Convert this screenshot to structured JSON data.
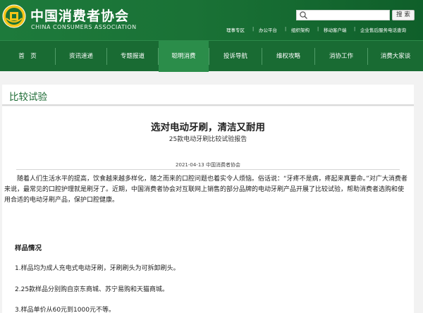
{
  "header": {
    "brand_cn": "中国消费者协会",
    "brand_en": "CHINA CONSUMERS ASSOCIATION",
    "search_placeholder": "",
    "search_button": "搜 索",
    "quick_links": [
      "理事专区",
      "办公平台",
      "组织架构",
      "移动客户端",
      "企业售后服务电话查询"
    ]
  },
  "nav": {
    "items": [
      {
        "label": "首　页",
        "active": false
      },
      {
        "label": "资讯速递",
        "active": false
      },
      {
        "label": "专题报道",
        "active": false
      },
      {
        "label": "聪明消费",
        "active": true
      },
      {
        "label": "投诉导航",
        "active": false
      },
      {
        "label": "维权攻略",
        "active": false
      },
      {
        "label": "消协工作",
        "active": false
      },
      {
        "label": "消费大家谈",
        "active": false
      }
    ]
  },
  "section": {
    "title": "比较试验"
  },
  "article": {
    "title": "选对电动牙刷，清洁又耐用",
    "subtitle": "25款电动牙刷比较试验报告",
    "meta": "2021-04-13 中国消费者协会",
    "body": "随着人们生活水平的提高，饮食越来越多样化，随之而来的口腔问题也着实令人烦恼。俗话说：“牙疼不是病，疼起来真要命。”对广大消费者来说，最常见的口腔护理就是刷牙了。近期，中国消费者协会对互联网上销售的部分品牌的电动牙刷产品开展了比较试验，帮助消费者选购和使用合适的电动牙刷产品，保护口腔健康。",
    "sample_heading": "样品情况",
    "items": [
      "1.样品均为成人充电式电动牙刷，牙刷刷头为可拆卸刷头。",
      "2.25款样品分别购自京东商城、苏宁易购和天猫商城。",
      "3.样品单价从60元到1000元不等。"
    ]
  },
  "colors": {
    "header_green": "#1a7236",
    "nav_green": "#196b33",
    "nav_active": "#2b8d4a",
    "section_title": "#1d6b34"
  }
}
